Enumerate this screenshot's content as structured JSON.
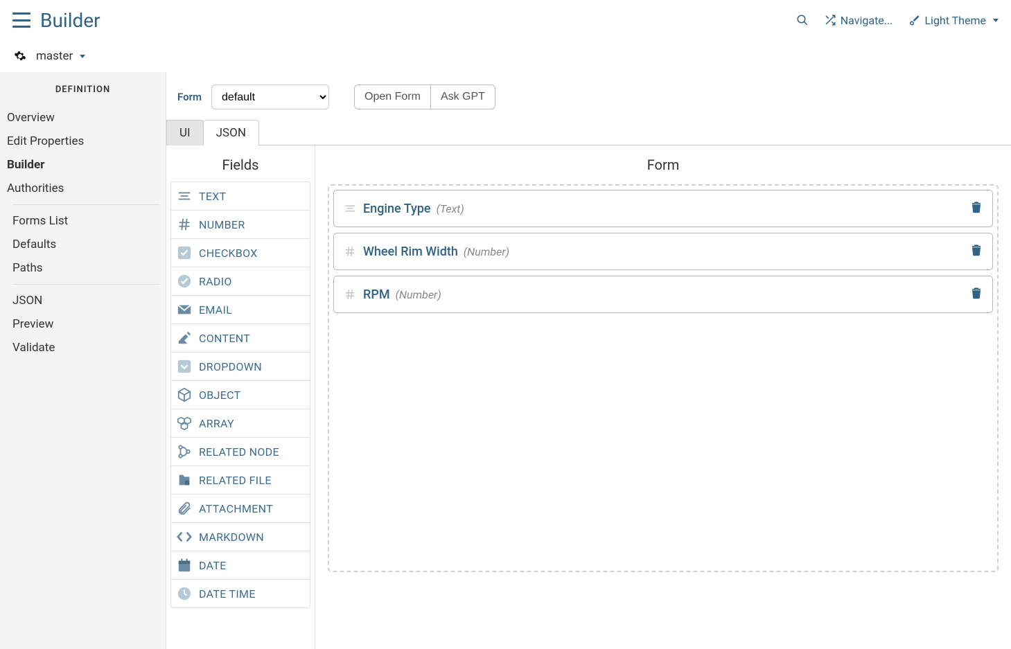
{
  "header": {
    "title": "Builder",
    "navigate": "Navigate...",
    "theme": "Light Theme"
  },
  "branch": {
    "name": "master"
  },
  "sidebar": {
    "heading": "DEFINITION",
    "group1": [
      "Overview",
      "Edit Properties",
      "Builder",
      "Authorities"
    ],
    "group2": [
      "Forms List",
      "Defaults",
      "Paths"
    ],
    "group3": [
      "JSON",
      "Preview",
      "Validate"
    ],
    "active": "Builder"
  },
  "formRow": {
    "label": "Form",
    "selectValue": "default",
    "openForm": "Open Form",
    "askGpt": "Ask GPT"
  },
  "tabs": {
    "ui": "UI",
    "json": "JSON",
    "active": "UI"
  },
  "fieldsPanel": {
    "heading": "Fields",
    "items": [
      {
        "label": "TEXT",
        "icon": "text"
      },
      {
        "label": "NUMBER",
        "icon": "number"
      },
      {
        "label": "CHECKBOX",
        "icon": "checkbox"
      },
      {
        "label": "RADIO",
        "icon": "radio"
      },
      {
        "label": "EMAIL",
        "icon": "email"
      },
      {
        "label": "CONTENT",
        "icon": "content"
      },
      {
        "label": "DROPDOWN",
        "icon": "dropdown"
      },
      {
        "label": "OBJECT",
        "icon": "object"
      },
      {
        "label": "ARRAY",
        "icon": "array"
      },
      {
        "label": "RELATED NODE",
        "icon": "relnode"
      },
      {
        "label": "RELATED FILE",
        "icon": "relfile"
      },
      {
        "label": "ATTACHMENT",
        "icon": "attachment"
      },
      {
        "label": "MARKDOWN",
        "icon": "markdown"
      },
      {
        "label": "DATE",
        "icon": "date"
      },
      {
        "label": "DATE TIME",
        "icon": "datetime"
      }
    ]
  },
  "formPanel": {
    "heading": "Form",
    "fields": [
      {
        "name": "Engine Type",
        "type": "(Text)",
        "icon": "text"
      },
      {
        "name": "Wheel Rim Width",
        "type": "(Number)",
        "icon": "number"
      },
      {
        "name": "RPM",
        "type": "(Number)",
        "icon": "number"
      }
    ]
  }
}
